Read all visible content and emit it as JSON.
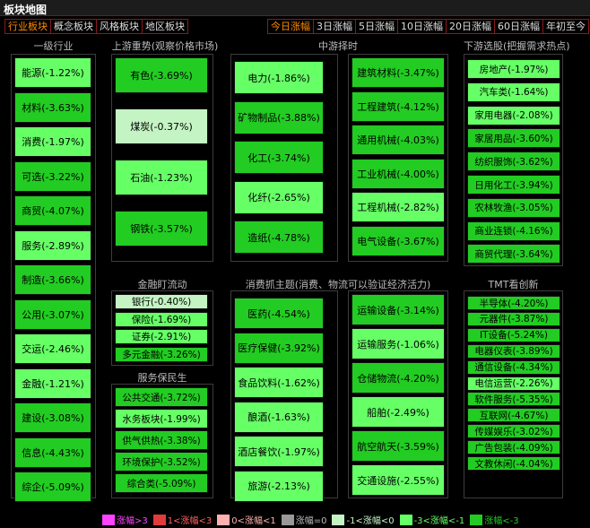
{
  "app_title": "板块地图",
  "tabs_left": [
    "行业板块",
    "概念板块",
    "风格板块",
    "地区板块"
  ],
  "tabs_right": [
    "今日涨幅",
    "3日涨幅",
    "5日涨幅",
    "10日涨幅",
    "20日涨幅",
    "60日涨幅",
    "年初至今"
  ],
  "colors": {
    "strong_down": "#22cc22",
    "mid_down": "#66ff66",
    "light_down": "#c4f4c4",
    "flat": "#999999",
    "light_up": "#ffb0b0",
    "up": "#e03c3c",
    "strong_up": "#ff44ff",
    "accent": "#ff8c00",
    "border": "#8b1a1a"
  },
  "sections": [
    {
      "title": "一级行业",
      "items": [
        {
          "label": "能源(-1.22%)",
          "level": "m"
        },
        {
          "label": "材料(-3.63%)",
          "level": "s"
        },
        {
          "label": "消费(-1.97%)",
          "level": "m"
        },
        {
          "label": "可选(-3.22%)",
          "level": "s"
        },
        {
          "label": "商贸(-4.07%)",
          "level": "s"
        },
        {
          "label": "服务(-2.89%)",
          "level": "m"
        },
        {
          "label": "制造(-3.66%)",
          "level": "s"
        },
        {
          "label": "公用(-3.07%)",
          "level": "s"
        },
        {
          "label": "交运(-2.46%)",
          "level": "m"
        },
        {
          "label": "金融(-1.21%)",
          "level": "m"
        },
        {
          "label": "建设(-3.08%)",
          "level": "s"
        },
        {
          "label": "信息(-4.43%)",
          "level": "s"
        },
        {
          "label": "综企(-5.09%)",
          "level": "s"
        }
      ]
    },
    {
      "title": "上游重势(观察价格市场)",
      "items": [
        {
          "label": "有色(-3.69%)",
          "level": "s"
        },
        {
          "label": "煤炭(-0.37%)",
          "level": "l"
        },
        {
          "label": "石油(-1.23%)",
          "level": "m"
        },
        {
          "label": "钢铁(-3.57%)",
          "level": "s"
        }
      ]
    },
    {
      "title": "金融盯流动",
      "items": [
        {
          "label": "银行(-0.40%)",
          "level": "l"
        },
        {
          "label": "保险(-1.69%)",
          "level": "m"
        },
        {
          "label": "证券(-2.91%)",
          "level": "m"
        },
        {
          "label": "多元金融(-3.26%)",
          "level": "s"
        }
      ]
    },
    {
      "title": "服务保民生",
      "items": [
        {
          "label": "公共交通(-3.72%)",
          "level": "s"
        },
        {
          "label": "水务板块(-1.99%)",
          "level": "m"
        },
        {
          "label": "供气供热(-3.38%)",
          "level": "s"
        },
        {
          "label": "环境保护(-3.52%)",
          "level": "s"
        },
        {
          "label": "综合类(-5.09%)",
          "level": "s"
        }
      ]
    },
    {
      "title": "中游择时",
      "items": [
        {
          "label": "电力(-1.86%)",
          "level": "m"
        },
        {
          "label": "矿物制品(-3.88%)",
          "level": "s"
        },
        {
          "label": "化工(-3.74%)",
          "level": "s"
        },
        {
          "label": "化纤(-2.65%)",
          "level": "m"
        },
        {
          "label": "造纸(-4.78%)",
          "level": "s"
        }
      ]
    },
    {
      "title": "",
      "items": [
        {
          "label": "建筑材料(-3.47%)",
          "level": "s"
        },
        {
          "label": "工程建筑(-4.12%)",
          "level": "s"
        },
        {
          "label": "通用机械(-4.03%)",
          "level": "s"
        },
        {
          "label": "工业机械(-4.00%)",
          "level": "s"
        },
        {
          "label": "工程机械(-2.82%)",
          "level": "m"
        },
        {
          "label": "电气设备(-3.67%)",
          "level": "s"
        }
      ]
    },
    {
      "title": "消费抓主题(消费、物流可以验证经济活力)",
      "items": [
        {
          "label": "医药(-4.54%)",
          "level": "s"
        },
        {
          "label": "医疗保健(-3.92%)",
          "level": "s"
        },
        {
          "label": "食品饮料(-1.62%)",
          "level": "m"
        },
        {
          "label": "酿酒(-1.63%)",
          "level": "m"
        },
        {
          "label": "酒店餐饮(-1.97%)",
          "level": "m"
        },
        {
          "label": "旅游(-2.13%)",
          "level": "m"
        }
      ]
    },
    {
      "title": "",
      "items": [
        {
          "label": "运输设备(-3.14%)",
          "level": "s"
        },
        {
          "label": "运输服务(-1.06%)",
          "level": "m"
        },
        {
          "label": "仓储物流(-4.20%)",
          "level": "s"
        },
        {
          "label": "船舶(-2.49%)",
          "level": "m"
        },
        {
          "label": "航空航天(-3.59%)",
          "level": "s"
        },
        {
          "label": "交通设施(-2.55%)",
          "level": "m"
        }
      ]
    },
    {
      "title": "下游选股(把握需求热点)",
      "items": [
        {
          "label": "房地产(-1.97%)",
          "level": "m"
        },
        {
          "label": "汽车类(-1.64%)",
          "level": "m"
        },
        {
          "label": "家用电器(-2.08%)",
          "level": "m"
        },
        {
          "label": "家居用品(-3.60%)",
          "level": "s"
        },
        {
          "label": "纺织服饰(-3.62%)",
          "level": "s"
        },
        {
          "label": "日用化工(-3.94%)",
          "level": "s"
        },
        {
          "label": "农林牧渔(-3.05%)",
          "level": "s"
        },
        {
          "label": "商业连锁(-4.16%)",
          "level": "s"
        },
        {
          "label": "商贸代理(-3.64%)",
          "level": "s"
        }
      ]
    },
    {
      "title": "TMT看创新",
      "items": [
        {
          "label": "半导体(-4.20%)",
          "level": "s"
        },
        {
          "label": "元器件(-3.87%)",
          "level": "s"
        },
        {
          "label": "IT设备(-5.24%)",
          "level": "s"
        },
        {
          "label": "电器仪表(-3.89%)",
          "level": "s"
        },
        {
          "label": "通信设备(-4.34%)",
          "level": "s"
        },
        {
          "label": "电信运营(-2.26%)",
          "level": "m"
        },
        {
          "label": "软件服务(-5.35%)",
          "level": "s"
        },
        {
          "label": "互联网(-4.67%)",
          "level": "s"
        },
        {
          "label": "传媒娱乐(-3.02%)",
          "level": "s"
        },
        {
          "label": "广告包装(-4.09%)",
          "level": "s"
        },
        {
          "label": "文教休闲(-4.04%)",
          "level": "s"
        }
      ]
    }
  ],
  "legend": [
    {
      "label": "涨幅>3",
      "color": "#ff44ff",
      "text_color": "#ff44ff"
    },
    {
      "label": "1<涨幅<3",
      "color": "#e03c3c",
      "text_color": "#ff6060"
    },
    {
      "label": "0<涨幅<1",
      "color": "#ffb0b0",
      "text_color": "#ffb0b0"
    },
    {
      "label": "涨幅=0",
      "color": "#999999",
      "text_color": "#bbbbbb"
    },
    {
      "label": "-1<涨幅<0",
      "color": "#c4f4c4",
      "text_color": "#c4f4c4"
    },
    {
      "label": "-3<涨幅<-1",
      "color": "#66ff66",
      "text_color": "#66ff66"
    },
    {
      "label": "涨幅<-3",
      "color": "#22cc22",
      "text_color": "#22cc22"
    }
  ]
}
